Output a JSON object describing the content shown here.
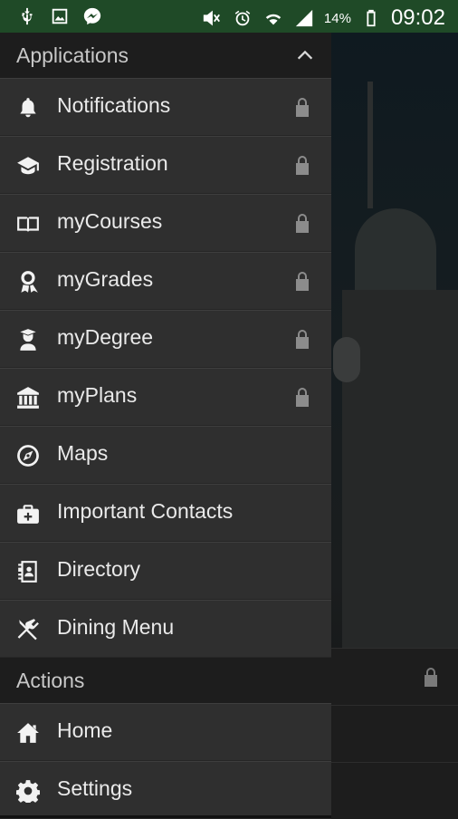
{
  "status_bar": {
    "battery_percent": "14%",
    "time": "09:02",
    "left_icons": [
      "usb-icon",
      "image-icon",
      "messenger-icon"
    ],
    "right_icons": [
      "mute-icon",
      "alarm-icon",
      "wifi-icon",
      "signal-icon",
      "battery-icon"
    ]
  },
  "drawer": {
    "applications_header": "Applications",
    "applications": [
      {
        "label": "Notifications",
        "icon": "bell-icon",
        "locked": true
      },
      {
        "label": "Registration",
        "icon": "graduation-cap-icon",
        "locked": true
      },
      {
        "label": "myCourses",
        "icon": "book-icon",
        "locked": true
      },
      {
        "label": "myGrades",
        "icon": "ribbon-icon",
        "locked": true
      },
      {
        "label": "myDegree",
        "icon": "graduate-icon",
        "locked": true
      },
      {
        "label": "myPlans",
        "icon": "bank-icon",
        "locked": true
      },
      {
        "label": "Maps",
        "icon": "compass-icon",
        "locked": false
      },
      {
        "label": "Important Contacts",
        "icon": "medkit-icon",
        "locked": false
      },
      {
        "label": "Directory",
        "icon": "address-book-icon",
        "locked": false
      },
      {
        "label": "Dining Menu",
        "icon": "utensils-icon",
        "locked": false
      }
    ],
    "actions_header": "Actions",
    "actions": [
      {
        "label": "Home",
        "icon": "home-icon"
      },
      {
        "label": "Settings",
        "icon": "gear-icon"
      }
    ]
  },
  "colors": {
    "status_bar": "#1f4a27",
    "drawer_bg": "#2f2f2f",
    "section_header_bg": "#1d1d1d",
    "lock_gray": "#8c8c8c"
  }
}
